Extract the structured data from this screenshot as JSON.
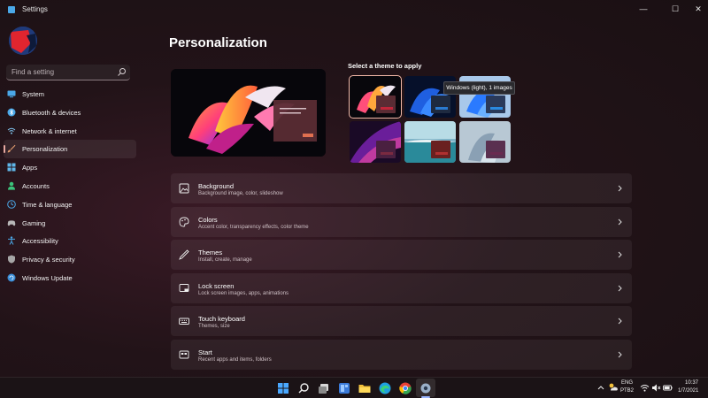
{
  "window": {
    "title": "Settings",
    "min_glyph": "—",
    "max_glyph": "☐",
    "close_glyph": "✕"
  },
  "sidebar": {
    "search_placeholder": "Find a setting",
    "items": [
      {
        "label": "System",
        "icon": "monitor-icon",
        "color": "#4aa8e8"
      },
      {
        "label": "Bluetooth & devices",
        "icon": "bluetooth-icon",
        "color": "#4aa8e8"
      },
      {
        "label": "Network & internet",
        "icon": "wifi-icon",
        "color": "#7fc4ee"
      },
      {
        "label": "Personalization",
        "icon": "brush-icon",
        "color": "#e8a070",
        "active": true
      },
      {
        "label": "Apps",
        "icon": "apps-icon",
        "color": "#5fb6e8"
      },
      {
        "label": "Accounts",
        "icon": "person-icon",
        "color": "#3bc27a"
      },
      {
        "label": "Time & language",
        "icon": "globe-clock-icon",
        "color": "#4aa8e8"
      },
      {
        "label": "Gaming",
        "icon": "gamepad-icon",
        "color": "#b8b8b8"
      },
      {
        "label": "Accessibility",
        "icon": "accessibility-icon",
        "color": "#4aa8e8"
      },
      {
        "label": "Privacy & security",
        "icon": "shield-icon",
        "color": "#a6a6a6"
      },
      {
        "label": "Windows Update",
        "icon": "update-icon",
        "color": "#3b8ed8"
      }
    ]
  },
  "main": {
    "title": "Personalization",
    "themes_heading": "Select a theme to apply",
    "tooltip": "Windows (light), 1 images",
    "cards": [
      {
        "title": "Background",
        "subtitle": "Background image, color, slideshow",
        "icon": "image-icon"
      },
      {
        "title": "Colors",
        "subtitle": "Accent color, transparency effects, color theme",
        "icon": "palette-icon"
      },
      {
        "title": "Themes",
        "subtitle": "Install, create, manage",
        "icon": "pen-icon"
      },
      {
        "title": "Lock screen",
        "subtitle": "Lock screen images, apps, animations",
        "icon": "lock-screen-icon"
      },
      {
        "title": "Touch keyboard",
        "subtitle": "Themes, size",
        "icon": "keyboard-icon"
      },
      {
        "title": "Start",
        "subtitle": "Recent apps and items, folders",
        "icon": "start-icon"
      }
    ],
    "theme_accents": [
      "#c0263a",
      "#2a7ad0",
      "#2a8ae0",
      "#7a2a40",
      "#b03030",
      "#6a2a50"
    ]
  },
  "taskbar": {
    "language": "ENG",
    "keyboard": "PTB2",
    "time": "10:37",
    "date": "1/7/2021",
    "icons": [
      "windows-start-icon",
      "search-icon",
      "task-view-icon",
      "widgets-icon",
      "file-explorer-icon",
      "edge-icon",
      "chrome-icon",
      "settings-icon"
    ]
  }
}
